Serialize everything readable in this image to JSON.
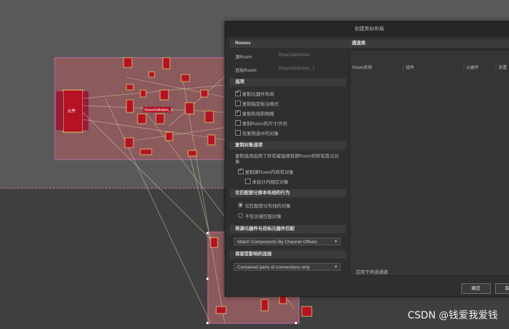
{
  "dialog": {
    "title": "创建类似布局",
    "rooms_section": "Rooms",
    "source_room_label": "源Room",
    "source_room_value": "RoomDefinition",
    "target_room_label": "目标Room",
    "target_room_value": "RoomDefinition_1",
    "options_section": "选项",
    "options": [
      {
        "label": "复制元器件布局",
        "checked": true
      },
      {
        "label": "复制指定标注格式",
        "checked": false
      },
      {
        "label": "复制布线和网络",
        "checked": true
      },
      {
        "label": "复制Room的尺寸/外形",
        "checked": false
      },
      {
        "label": "仅复制选中的对象",
        "checked": false
      }
    ],
    "copied_objects_section": "复制对象选项",
    "copied_objects_desc": "复制选项启用了所有被选择到源Room的所有其元对象",
    "copy_all_label": "复制源Room内所有对象",
    "copy_all_checked": true,
    "only_selected_label": "本设计内相应对象",
    "only_selected_checked": false,
    "partial_section": "仅匹配部分原本布线的行为",
    "partial_opt1": "仅匹配部分布线的对象",
    "partial_opt2": "不包含被匹配对象",
    "match_section": "将源元器件与目标元器件匹配",
    "match_value": "Match Components By Channel Offsets",
    "affected_section": "保留受影响的连接",
    "affected_value": "Contained parts of connections only",
    "channels_section": "通道类",
    "columns": [
      "Room名称",
      "组件",
      "元器件",
      "放置"
    ],
    "apply_label": "应用于所选通道",
    "ok_button": "确定",
    "cancel_button": "取消"
  },
  "canvas": {
    "room_label": "RoomDefinition_1",
    "component_label": "元件"
  },
  "watermark": "CSDN @钱爱我爱钱"
}
